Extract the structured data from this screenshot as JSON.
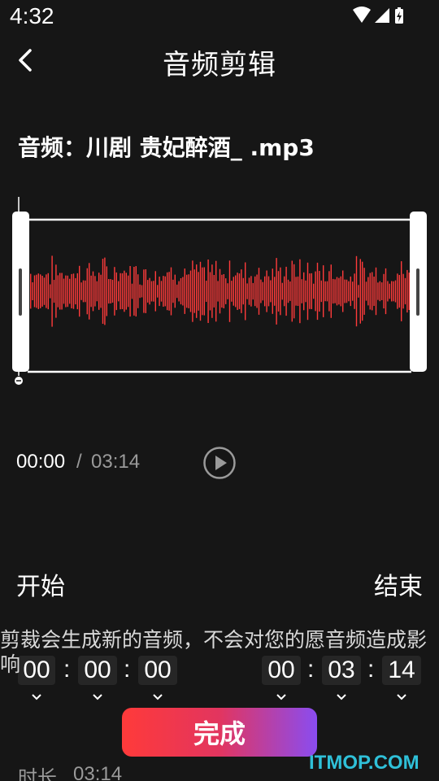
{
  "status_bar": {
    "time": "4:32",
    "icons": [
      "wifi-icon",
      "signal-icon",
      "battery-icon"
    ]
  },
  "header": {
    "back_icon": "chevron-left-icon",
    "title": "音频剪辑"
  },
  "audio": {
    "label": "音频：川剧 贵妃醉酒_ .mp3"
  },
  "waveform": {
    "color": "#ff3b3b",
    "handle_color": "#ffffff"
  },
  "playback": {
    "current": "00:00",
    "separator": "/",
    "total": "03:14",
    "play_icon": "play-circle-icon"
  },
  "range": {
    "start_label": "开始",
    "end_label": "结束",
    "start": {
      "h": "00",
      "m": "00",
      "s": "00"
    },
    "end": {
      "h": "00",
      "m": "03",
      "s": "14"
    },
    "separator": ":"
  },
  "notice": "剪裁会生成新的音频，不会对您的愿音频造成影响",
  "actions": {
    "done_label": "完成",
    "gradient_start": "#ff3a3a",
    "gradient_end": "#8a4cf0"
  },
  "duration": {
    "label": "时长",
    "value": "03:14"
  },
  "watermark": "ITMOP.COM"
}
